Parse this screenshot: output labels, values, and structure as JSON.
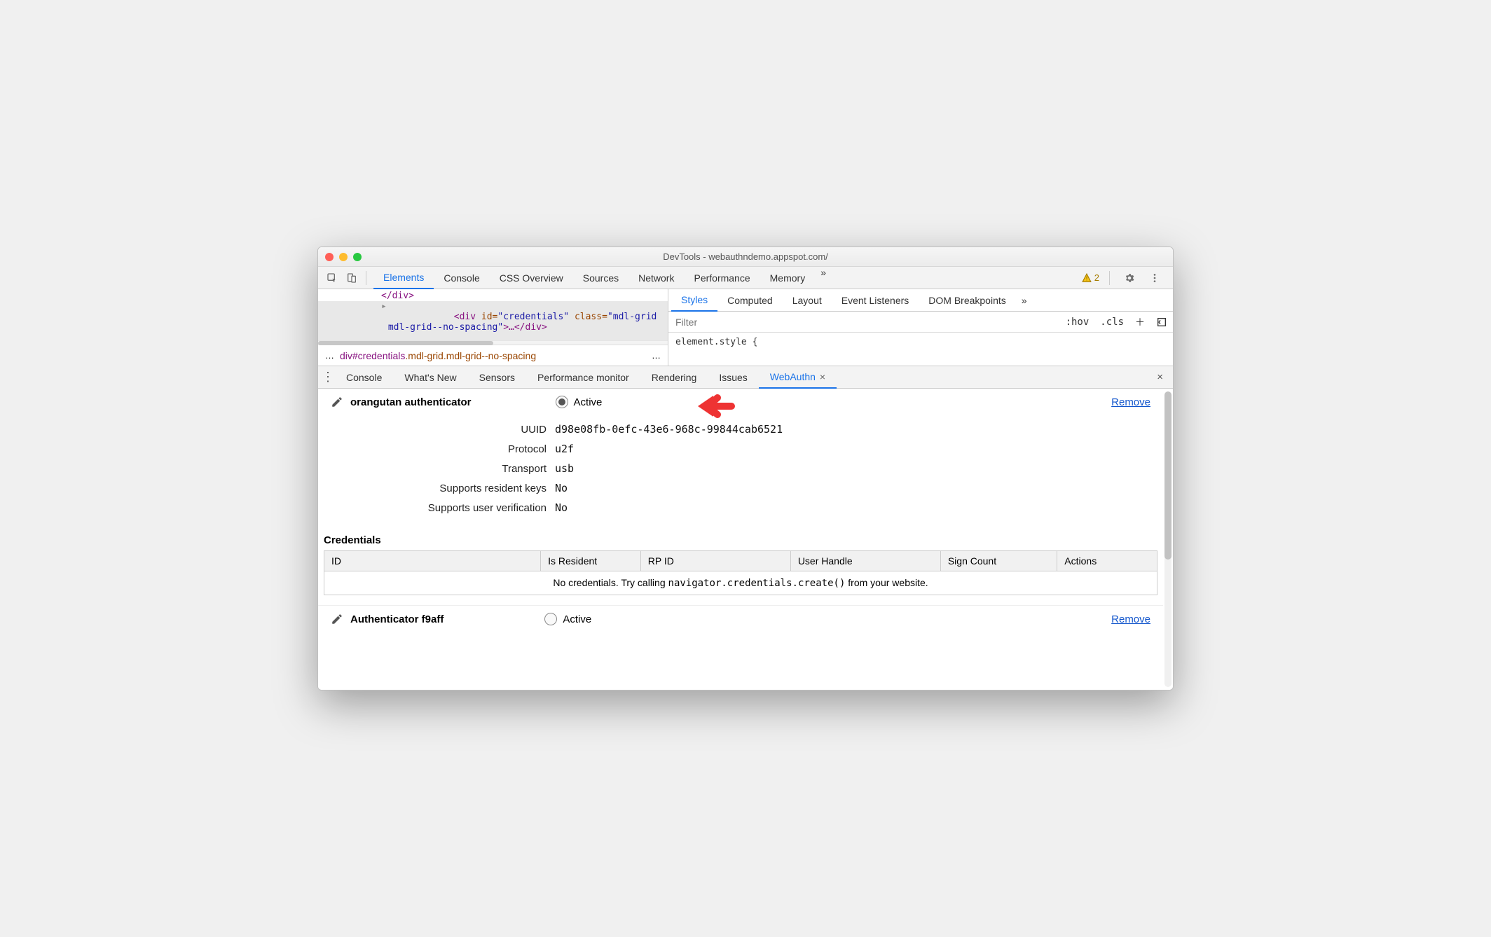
{
  "window": {
    "title": "DevTools - webauthndemo.appspot.com/"
  },
  "mainTabs": {
    "items": [
      "Elements",
      "Console",
      "CSS Overview",
      "Sources",
      "Network",
      "Performance",
      "Memory"
    ],
    "more": "»",
    "warningCount": "2"
  },
  "domPanel": {
    "closingDiv": "</div>",
    "highlightedPrefix": "▸",
    "tagOpen": "<div ",
    "idAttr": "id=",
    "idVal": "\"credentials\"",
    "classAttr": " class=",
    "classVal": "\"mdl-grid mdl-grid--no-spacing\"",
    "tagClose": ">…</div>",
    "partialLine": "</div",
    "breadcrumbLeft": "…",
    "breadcrumb": "div#credentials",
    "breadcrumbClasses": ".mdl-grid.mdl-grid--no-spacing",
    "breadcrumbRight": "…"
  },
  "stylesPanel": {
    "tabs": [
      "Styles",
      "Computed",
      "Layout",
      "Event Listeners",
      "DOM Breakpoints"
    ],
    "more": "»",
    "filterPlaceholder": "Filter",
    "hov": ":hov",
    "cls": ".cls",
    "body": "element.style {"
  },
  "drawer": {
    "tabs": [
      "Console",
      "What's New",
      "Sensors",
      "Performance monitor",
      "Rendering",
      "Issues",
      "WebAuthn"
    ],
    "activeTabCloseGlyph": "×",
    "closeGlyph": "×"
  },
  "authenticator1": {
    "name": "orangutan authenticator",
    "activeLabel": "Active",
    "removeLabel": "Remove",
    "fields": {
      "uuidLabel": "UUID",
      "uuidValue": "d98e08fb-0efc-43e6-968c-99844cab6521",
      "protocolLabel": "Protocol",
      "protocolValue": "u2f",
      "transportLabel": "Transport",
      "transportValue": "usb",
      "residentLabel": "Supports resident keys",
      "residentValue": "No",
      "userVerLabel": "Supports user verification",
      "userVerValue": "No"
    }
  },
  "credentials": {
    "heading": "Credentials",
    "columns": {
      "id": "ID",
      "isResident": "Is Resident",
      "rpid": "RP ID",
      "userHandle": "User Handle",
      "signCount": "Sign Count",
      "actions": "Actions"
    },
    "emptyLead": "No credentials. Try calling ",
    "emptyCode": "navigator.credentials.create()",
    "emptyTail": " from your website."
  },
  "authenticator2": {
    "name": "Authenticator f9aff",
    "activeLabel": "Active",
    "removeLabel": "Remove"
  }
}
